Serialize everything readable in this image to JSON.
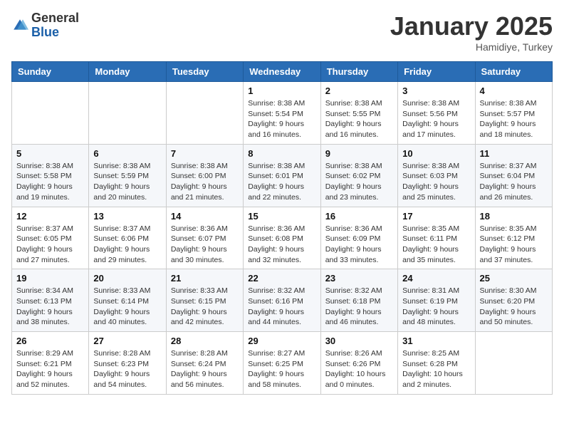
{
  "header": {
    "logo": {
      "general": "General",
      "blue": "Blue"
    },
    "month": "January 2025",
    "location": "Hamidiye, Turkey"
  },
  "weekdays": [
    "Sunday",
    "Monday",
    "Tuesday",
    "Wednesday",
    "Thursday",
    "Friday",
    "Saturday"
  ],
  "weeks": [
    [
      {
        "day": "",
        "info": ""
      },
      {
        "day": "",
        "info": ""
      },
      {
        "day": "",
        "info": ""
      },
      {
        "day": "1",
        "info": "Sunrise: 8:38 AM\nSunset: 5:54 PM\nDaylight: 9 hours\nand 16 minutes."
      },
      {
        "day": "2",
        "info": "Sunrise: 8:38 AM\nSunset: 5:55 PM\nDaylight: 9 hours\nand 16 minutes."
      },
      {
        "day": "3",
        "info": "Sunrise: 8:38 AM\nSunset: 5:56 PM\nDaylight: 9 hours\nand 17 minutes."
      },
      {
        "day": "4",
        "info": "Sunrise: 8:38 AM\nSunset: 5:57 PM\nDaylight: 9 hours\nand 18 minutes."
      }
    ],
    [
      {
        "day": "5",
        "info": "Sunrise: 8:38 AM\nSunset: 5:58 PM\nDaylight: 9 hours\nand 19 minutes."
      },
      {
        "day": "6",
        "info": "Sunrise: 8:38 AM\nSunset: 5:59 PM\nDaylight: 9 hours\nand 20 minutes."
      },
      {
        "day": "7",
        "info": "Sunrise: 8:38 AM\nSunset: 6:00 PM\nDaylight: 9 hours\nand 21 minutes."
      },
      {
        "day": "8",
        "info": "Sunrise: 8:38 AM\nSunset: 6:01 PM\nDaylight: 9 hours\nand 22 minutes."
      },
      {
        "day": "9",
        "info": "Sunrise: 8:38 AM\nSunset: 6:02 PM\nDaylight: 9 hours\nand 23 minutes."
      },
      {
        "day": "10",
        "info": "Sunrise: 8:38 AM\nSunset: 6:03 PM\nDaylight: 9 hours\nand 25 minutes."
      },
      {
        "day": "11",
        "info": "Sunrise: 8:37 AM\nSunset: 6:04 PM\nDaylight: 9 hours\nand 26 minutes."
      }
    ],
    [
      {
        "day": "12",
        "info": "Sunrise: 8:37 AM\nSunset: 6:05 PM\nDaylight: 9 hours\nand 27 minutes."
      },
      {
        "day": "13",
        "info": "Sunrise: 8:37 AM\nSunset: 6:06 PM\nDaylight: 9 hours\nand 29 minutes."
      },
      {
        "day": "14",
        "info": "Sunrise: 8:36 AM\nSunset: 6:07 PM\nDaylight: 9 hours\nand 30 minutes."
      },
      {
        "day": "15",
        "info": "Sunrise: 8:36 AM\nSunset: 6:08 PM\nDaylight: 9 hours\nand 32 minutes."
      },
      {
        "day": "16",
        "info": "Sunrise: 8:36 AM\nSunset: 6:09 PM\nDaylight: 9 hours\nand 33 minutes."
      },
      {
        "day": "17",
        "info": "Sunrise: 8:35 AM\nSunset: 6:11 PM\nDaylight: 9 hours\nand 35 minutes."
      },
      {
        "day": "18",
        "info": "Sunrise: 8:35 AM\nSunset: 6:12 PM\nDaylight: 9 hours\nand 37 minutes."
      }
    ],
    [
      {
        "day": "19",
        "info": "Sunrise: 8:34 AM\nSunset: 6:13 PM\nDaylight: 9 hours\nand 38 minutes."
      },
      {
        "day": "20",
        "info": "Sunrise: 8:33 AM\nSunset: 6:14 PM\nDaylight: 9 hours\nand 40 minutes."
      },
      {
        "day": "21",
        "info": "Sunrise: 8:33 AM\nSunset: 6:15 PM\nDaylight: 9 hours\nand 42 minutes."
      },
      {
        "day": "22",
        "info": "Sunrise: 8:32 AM\nSunset: 6:16 PM\nDaylight: 9 hours\nand 44 minutes."
      },
      {
        "day": "23",
        "info": "Sunrise: 8:32 AM\nSunset: 6:18 PM\nDaylight: 9 hours\nand 46 minutes."
      },
      {
        "day": "24",
        "info": "Sunrise: 8:31 AM\nSunset: 6:19 PM\nDaylight: 9 hours\nand 48 minutes."
      },
      {
        "day": "25",
        "info": "Sunrise: 8:30 AM\nSunset: 6:20 PM\nDaylight: 9 hours\nand 50 minutes."
      }
    ],
    [
      {
        "day": "26",
        "info": "Sunrise: 8:29 AM\nSunset: 6:21 PM\nDaylight: 9 hours\nand 52 minutes."
      },
      {
        "day": "27",
        "info": "Sunrise: 8:28 AM\nSunset: 6:23 PM\nDaylight: 9 hours\nand 54 minutes."
      },
      {
        "day": "28",
        "info": "Sunrise: 8:28 AM\nSunset: 6:24 PM\nDaylight: 9 hours\nand 56 minutes."
      },
      {
        "day": "29",
        "info": "Sunrise: 8:27 AM\nSunset: 6:25 PM\nDaylight: 9 hours\nand 58 minutes."
      },
      {
        "day": "30",
        "info": "Sunrise: 8:26 AM\nSunset: 6:26 PM\nDaylight: 10 hours\nand 0 minutes."
      },
      {
        "day": "31",
        "info": "Sunrise: 8:25 AM\nSunset: 6:28 PM\nDaylight: 10 hours\nand 2 minutes."
      },
      {
        "day": "",
        "info": ""
      }
    ]
  ]
}
